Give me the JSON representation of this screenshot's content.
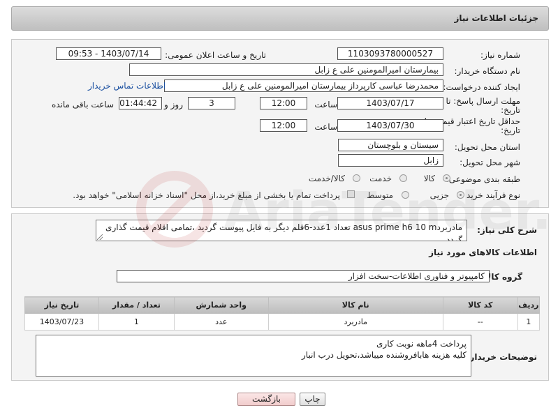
{
  "header": {
    "title": "جزئیات اطلاعات نیاز"
  },
  "form": {
    "need_number_label": "شماره نیاز:",
    "need_number": "1103093780000527",
    "announce_label": "تاریخ و ساعت اعلان عمومی:",
    "announce_value": "1403/07/14 - 09:53",
    "buyer_org_label": "نام دستگاه خریدار:",
    "buyer_org": "بیمارستان امیرالمومنین علی  ع  زابل",
    "requester_label": "ایجاد کننده درخواست:",
    "requester": "محمدرضا عباسی کارپرداز بیمارستان امیرالمومنین علی  ع  زابل",
    "contact_link": "اطلاعات تماس خریدار",
    "deadline_label_1": "مهلت ارسال پاسخ: تا",
    "deadline_label_2": "تاریخ:",
    "deadline_date": "1403/07/17",
    "time_label": "ساعت",
    "deadline_time": "12:00",
    "days_value": "3",
    "days_label": "روز و",
    "remaining_time": "01:44:42",
    "remaining_label": "ساعت باقی مانده",
    "validity_label_1": "حداقل تاریخ اعتبار قیمت: تا",
    "validity_label_2": "تاریخ:",
    "validity_date": "1403/07/30",
    "validity_time": "12:00",
    "province_label": "استان محل تحویل:",
    "province": "سیستان و بلوچستان",
    "city_label": "شهر محل تحویل:",
    "city": "زابل",
    "category_label": "طبقه بندی موضوعی:",
    "category_options": [
      "کالا",
      "خدمت",
      "کالا/خدمت"
    ],
    "process_label": "نوع فرآیند خرید :",
    "process_options": [
      "جزیی",
      "متوسط"
    ],
    "payment_note": "پرداخت تمام یا بخشی از مبلغ خرید،از محل \"اسناد خزانه اسلامی\" خواهد بود."
  },
  "summary": {
    "label": "شرح کلی نیاز:",
    "text": "مادربردasus prime h6 10 m تعداد 1عدد-6قلم دیگر به فایل پیوست گردید ،تمامی اقلام قیمت گذاری گردد ."
  },
  "goods": {
    "section_title": "اطلاعات کالاهای مورد نیاز",
    "group_label": "گروه کالا:",
    "group_value": "کامپیوتر و فناوری اطلاعات-سخت افزار",
    "columns": [
      "ردیف",
      "کد کالا",
      "نام کالا",
      "واحد شمارش",
      "تعداد / مقدار",
      "تاریخ نیاز"
    ],
    "rows": [
      {
        "row": "1",
        "code": "--",
        "name": "مادربرد",
        "unit": "عدد",
        "qty": "1",
        "date": "1403/07/23"
      }
    ]
  },
  "buyer_notes": {
    "label": "توضیحات خریدار:",
    "line1": "پرداخت 4ماهه نوبت کاری",
    "line2": "کلیه هزینه هابافروشنده میباشد،تحویل درب انبار"
  },
  "buttons": {
    "print": "چاپ",
    "back": "بازگشت"
  },
  "watermark_text": "AriaTender.neT",
  "colors": {
    "link": "#1a4fa0",
    "back_button_bg": "#f7d9d9"
  }
}
